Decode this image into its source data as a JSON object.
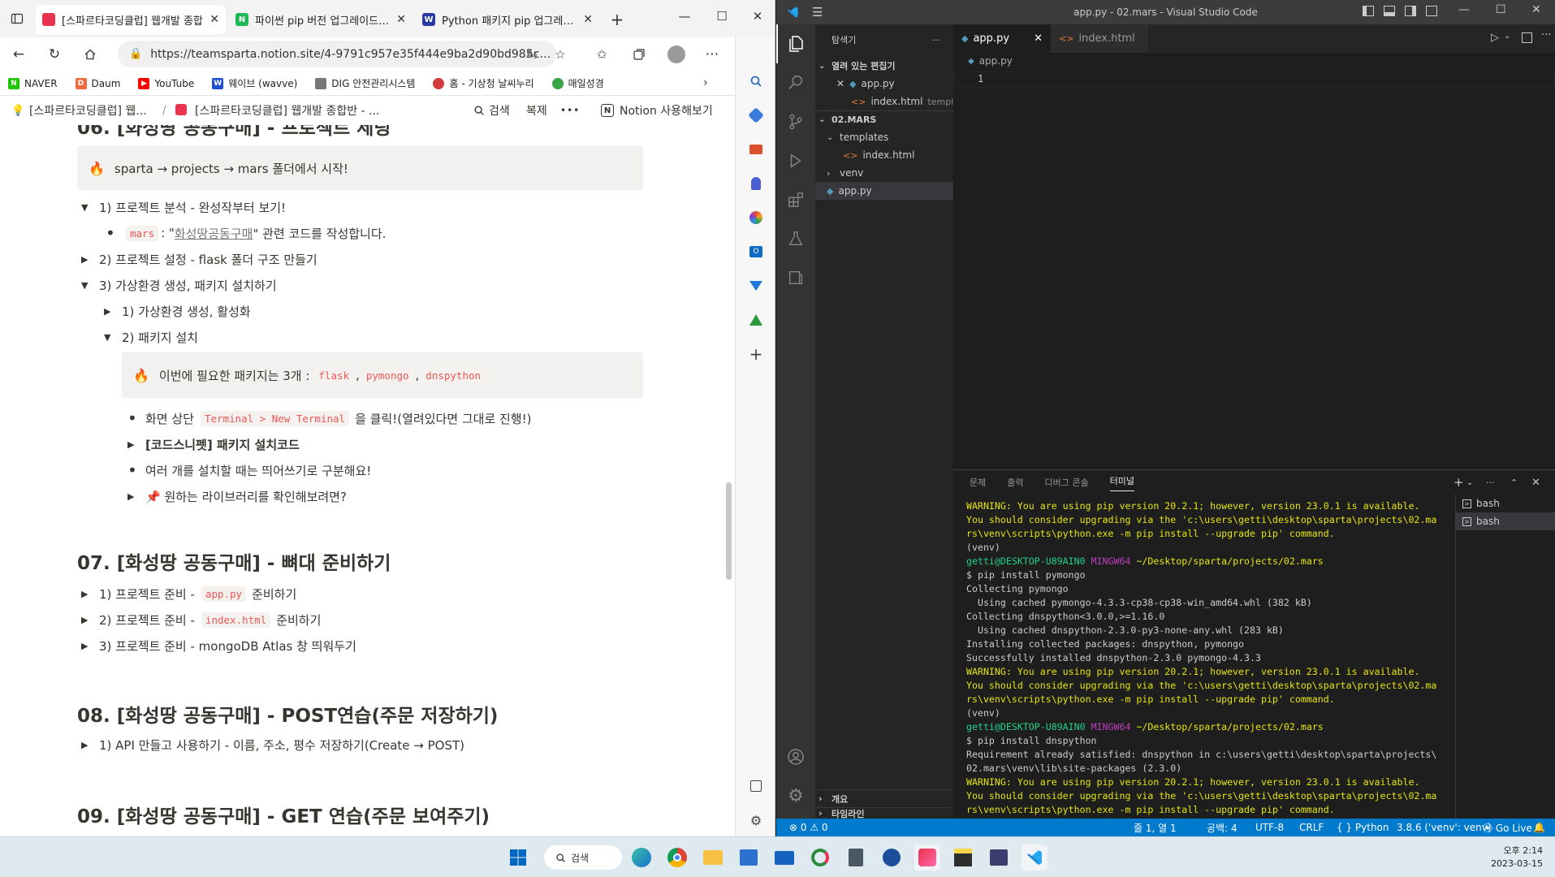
{
  "browser": {
    "tabs": [
      {
        "title": "[스파르타코딩클럽] 웹개발 종합",
        "active": true
      },
      {
        "title": "파이썬 pip 버전 업그레이드 : 냐",
        "active": false
      },
      {
        "title": "Python 패키지 pip 업그레이드,",
        "active": false
      }
    ],
    "new_tab": "+",
    "url": "https://teamsparta.notion.site/4-9791c957e35f444e9ba2d90bd985c15...",
    "bookmarks": [
      "NAVER",
      "Daum",
      "YouTube",
      "웨이브 (wavve)",
      "DIG 안전관리시스템",
      "홈 - 기상청 날씨누리",
      "매일성경"
    ],
    "win": {
      "minimize": "—",
      "maximize": "☐",
      "close": "✕"
    }
  },
  "notion": {
    "breadcrumb1": "[스파르타코딩클럽] 웹...",
    "breadcrumb_sep": "/",
    "breadcrumb2": "[스파르타코딩클럽] 웹개발 종합반 - ...",
    "search": "검색",
    "duplicate": "복제",
    "more": "•••",
    "try_notion": "Notion 사용해보기",
    "partial_heading": "06. [화성땅 공동구매] - 프로젝트 세팅",
    "callout1": "sparta → projects → mars 폴더에서 시작!",
    "item1": "1) 프로젝트 분석 - 완성작부터 보기!",
    "item1_code": "mars",
    "item1_text_a": ": \"",
    "item1_link": "화성땅공동구매",
    "item1_text_b": "\" 관련 코드를 작성합니다.",
    "item2": "2) 프로젝트 설정 - flask 폴더 구조 만들기",
    "item3": "3) 가상환경 생성, 패키지 설치하기",
    "item3_1": "1) 가상환경 생성, 활성화",
    "item3_2": "2) 패키지 설치",
    "callout2_text": "이번에 필요한 패키지는 3개 :",
    "pkg1": "flask",
    "pkg2": "pymongo",
    "pkg3": "dnspython",
    "comma": ",",
    "b1_pre": "화면 상단",
    "b1_code": "Terminal > New Terminal",
    "b1_post": "을 클릭!(열려있다면 그대로 진행!)",
    "t1": "[코드스니펫] 패키지 설치코드",
    "b2": "여러 개를 설치할 때는 띄어쓰기로 구분해요!",
    "t2": "📌 원하는 라이브러리를 확인해보려면?",
    "h07": "07. [화성땅 공동구매] - 뼈대 준비하기",
    "h07_1_pre": "1) 프로젝트 준비 -",
    "h07_1_code": "app.py",
    "h07_1_post": "준비하기",
    "h07_2_pre": "2) 프로젝트 준비 -",
    "h07_2_code": "index.html",
    "h07_2_post": "준비하기",
    "h07_3": "3) 프로젝트 준비 - mongoDB Atlas 창 띄워두기",
    "h08": "08. [화성땅 공동구매] - POST연습(주문 저장하기)",
    "h08_1": "1) API 만들고 사용하기 - 이름, 주소, 평수 저장하기(Create → POST)",
    "h09": "09. [화성땅 공동구매] - GET 연습(주문 보여주기)"
  },
  "vscode": {
    "title": "app.py - 02.mars - Visual Studio Code",
    "explorer": "탐색기",
    "explorer_more": "···",
    "open_editors": "열려 있는 편집기",
    "open1": "app.py",
    "open2": "index.html",
    "open2_hint": "templ...",
    "folder": "02.MARS",
    "templates": "templates",
    "index": "index.html",
    "venv": "venv",
    "app": "app.py",
    "outline": "개요",
    "timeline": "타임라인",
    "tab1": "app.py",
    "tab2": "index.html",
    "breadcrumb": "app.py",
    "line1": "1",
    "panel_tabs": [
      "문제",
      "출력",
      "디버그 콘솔",
      "터미널"
    ],
    "shells": [
      "bash",
      "bash"
    ],
    "terminal": [
      {
        "t": "WARNING: You are using pip version 20.2.1; however, version 23.0.1 is available.",
        "c": "warn"
      },
      {
        "t": "You should consider upgrading via the 'c:\\users\\getti\\desktop\\sparta\\projects\\02.ma",
        "c": "warn"
      },
      {
        "t": "rs\\venv\\scripts\\python.exe -m pip install --upgrade pip' command.",
        "c": "warn"
      },
      {
        "t": "(venv)",
        "c": "norm"
      },
      {
        "t": "PROMPT",
        "c": "prompt"
      },
      {
        "t": "$ pip install pymongo",
        "c": "norm"
      },
      {
        "t": "Collecting pymongo",
        "c": "norm"
      },
      {
        "t": "  Using cached pymongo-4.3.3-cp38-cp38-win_amd64.whl (382 kB)",
        "c": "norm"
      },
      {
        "t": "Collecting dnspython<3.0.0,>=1.16.0",
        "c": "norm"
      },
      {
        "t": "  Using cached dnspython-2.3.0-py3-none-any.whl (283 kB)",
        "c": "norm"
      },
      {
        "t": "Installing collected packages: dnspython, pymongo",
        "c": "norm"
      },
      {
        "t": "Successfully installed dnspython-2.3.0 pymongo-4.3.3",
        "c": "norm"
      },
      {
        "t": "WARNING: You are using pip version 20.2.1; however, version 23.0.1 is available.",
        "c": "warn"
      },
      {
        "t": "You should consider upgrading via the 'c:\\users\\getti\\desktop\\sparta\\projects\\02.ma",
        "c": "warn"
      },
      {
        "t": "rs\\venv\\scripts\\python.exe -m pip install --upgrade pip' command.",
        "c": "warn"
      },
      {
        "t": "(venv)",
        "c": "norm"
      },
      {
        "t": "PROMPT",
        "c": "prompt"
      },
      {
        "t": "$ pip install dnspython",
        "c": "norm"
      },
      {
        "t": "Requirement already satisfied: dnspython in c:\\users\\getti\\desktop\\sparta\\projects\\",
        "c": "norm"
      },
      {
        "t": "02.mars\\venv\\lib\\site-packages (2.3.0)",
        "c": "norm"
      },
      {
        "t": "WARNING: You are using pip version 20.2.1; however, version 23.0.1 is available.",
        "c": "warn"
      },
      {
        "t": "You should consider upgrading via the 'c:\\users\\getti\\desktop\\sparta\\projects\\02.ma",
        "c": "warn"
      },
      {
        "t": "rs\\venv\\scripts\\python.exe -m pip install --upgrade pip' command.",
        "c": "warn"
      }
    ],
    "prompt_user": "getti@DESKTOP-U89AIN0",
    "prompt_host": "MINGW64",
    "prompt_path": "~/Desktop/sparta/projects/02.mars",
    "status": {
      "errors": "⊗ 0 ⚠ 0",
      "position": "줄 1, 열 1",
      "spaces": "공백: 4",
      "encoding": "UTF-8",
      "eol": "CRLF",
      "lang": "{ } Python",
      "interpreter": "3.8.6 ('venv': venv)",
      "golive": "⦿ Go Live"
    }
  },
  "taskbar": {
    "search": "검색",
    "time": "오후 2:14",
    "date": "2023-03-15"
  },
  "colors": {
    "vscode_blue": "#007acc",
    "notion_text": "#37352f",
    "code_red": "#eb5757",
    "warn_yellow": "#e5e510"
  }
}
